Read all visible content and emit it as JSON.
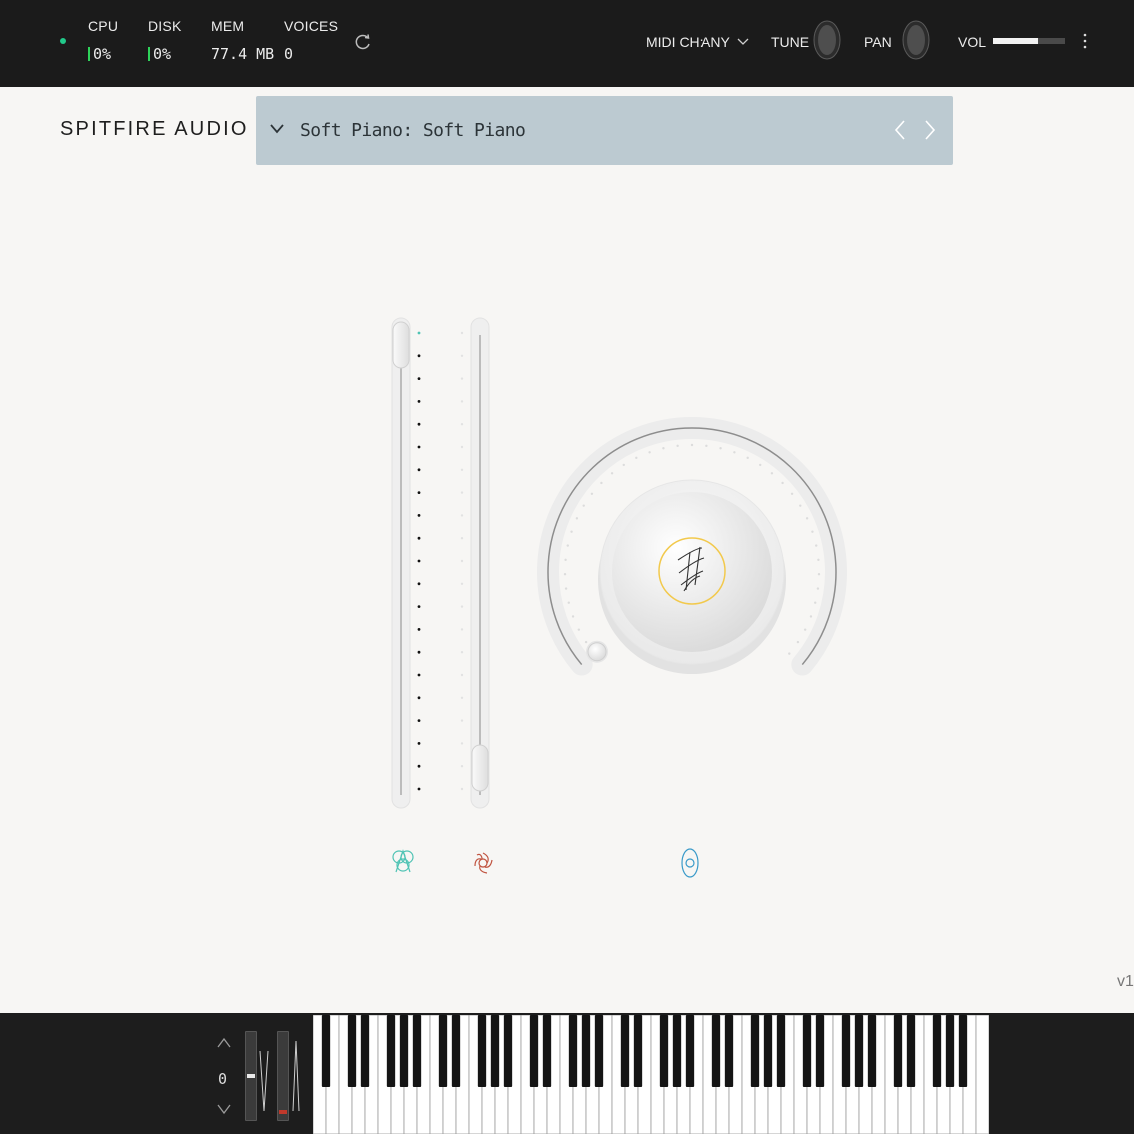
{
  "topbar": {
    "cpu_label": "CPU",
    "cpu_value": "0%",
    "disk_label": "DISK",
    "disk_value": "0%",
    "mem_label": "MEM",
    "mem_value": "77.4 MB",
    "voices_label": "VOICES",
    "voices_value": "0",
    "midi_label": "MIDI CH:",
    "midi_value": "ANY",
    "tune_label": "TUNE",
    "pan_label": "PAN",
    "vol_label": "VOL",
    "vol_level": 0.63,
    "power_color": "#21c98a",
    "meter_color": "#2ed35a"
  },
  "header": {
    "brand": "SPITFIRE AUDIO",
    "preset_name": "Soft Piano: Soft Piano"
  },
  "controls": {
    "expression_level": 1.0,
    "dynamics_level": 0.0,
    "reverb_level": 0.0,
    "expression_icon_color": "#4fc3b4",
    "dynamics_icon_color": "#c0533f",
    "reverb_icon_color": "#3a9ac9",
    "center_ring_color": "#f2c94c",
    "icons": [
      "expression-icon",
      "dynamics-icon",
      "reverb-icon",
      "spitfire-logo-icon"
    ]
  },
  "footer": {
    "version": "v1",
    "octave": "0"
  }
}
